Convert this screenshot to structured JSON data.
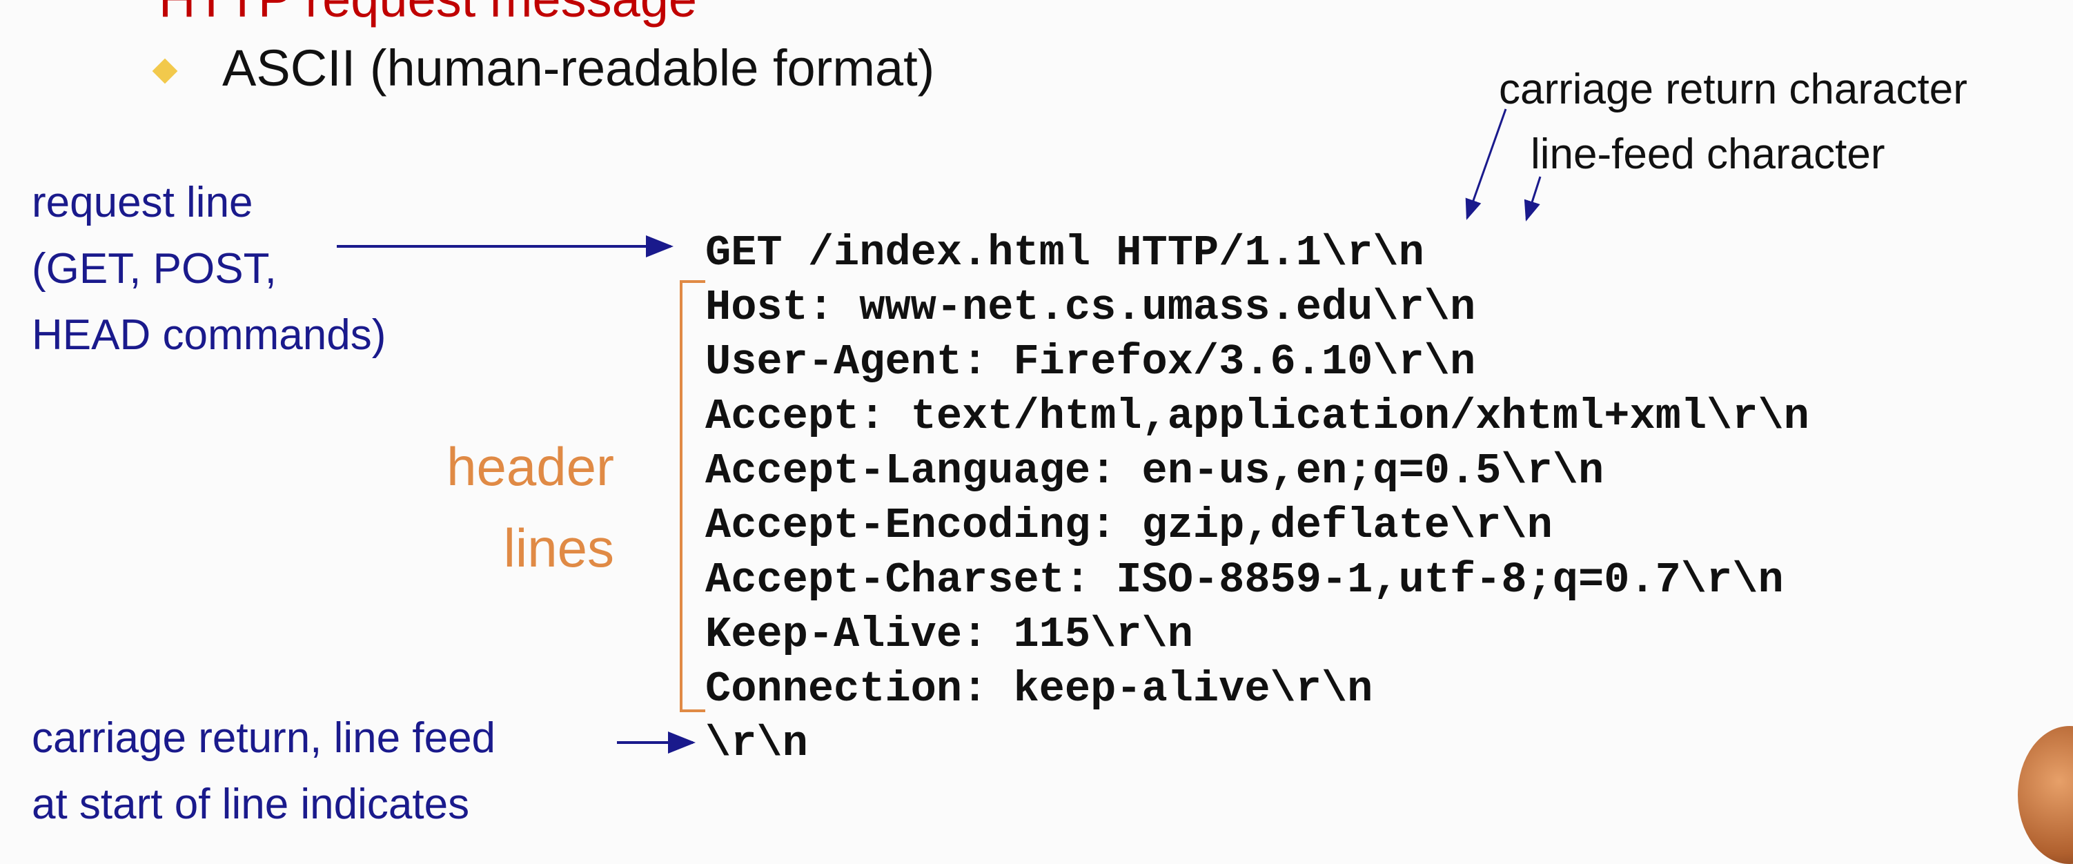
{
  "slide": {
    "title_cut": "HTTP request message",
    "bullet_text": "ASCII (human-readable format)"
  },
  "labels": {
    "request_line": [
      "request line",
      "(GET, POST,",
      "HEAD commands)"
    ],
    "header_lines": [
      "header",
      "lines"
    ],
    "end_label": [
      "carriage return, line feed",
      "at start of line indicates"
    ]
  },
  "annotations": {
    "carriage_return": "carriage return character",
    "line_feed": "line-feed character"
  },
  "request": {
    "request_line": "GET /index.html HTTP/1.1\\r\\n",
    "header_lines": [
      "Host: www-net.cs.umass.edu\\r\\n",
      "User-Agent: Firefox/3.6.10\\r\\n",
      "Accept: text/html,application/xhtml+xml\\r\\n",
      "Accept-Language: en-us,en;q=0.5\\r\\n",
      "Accept-Encoding: gzip,deflate\\r\\n",
      "Accept-Charset: ISO-8859-1,utf-8;q=0.7\\r\\n",
      "Keep-Alive: 115\\r\\n",
      "Connection: keep-alive\\r\\n"
    ],
    "blank_line": "\\r\\n"
  },
  "colors": {
    "label_blue": "#1a1a8c",
    "header_orange": "#e08a45",
    "title_red": "#c00000",
    "bullet_yellow": "#f2c94c"
  }
}
